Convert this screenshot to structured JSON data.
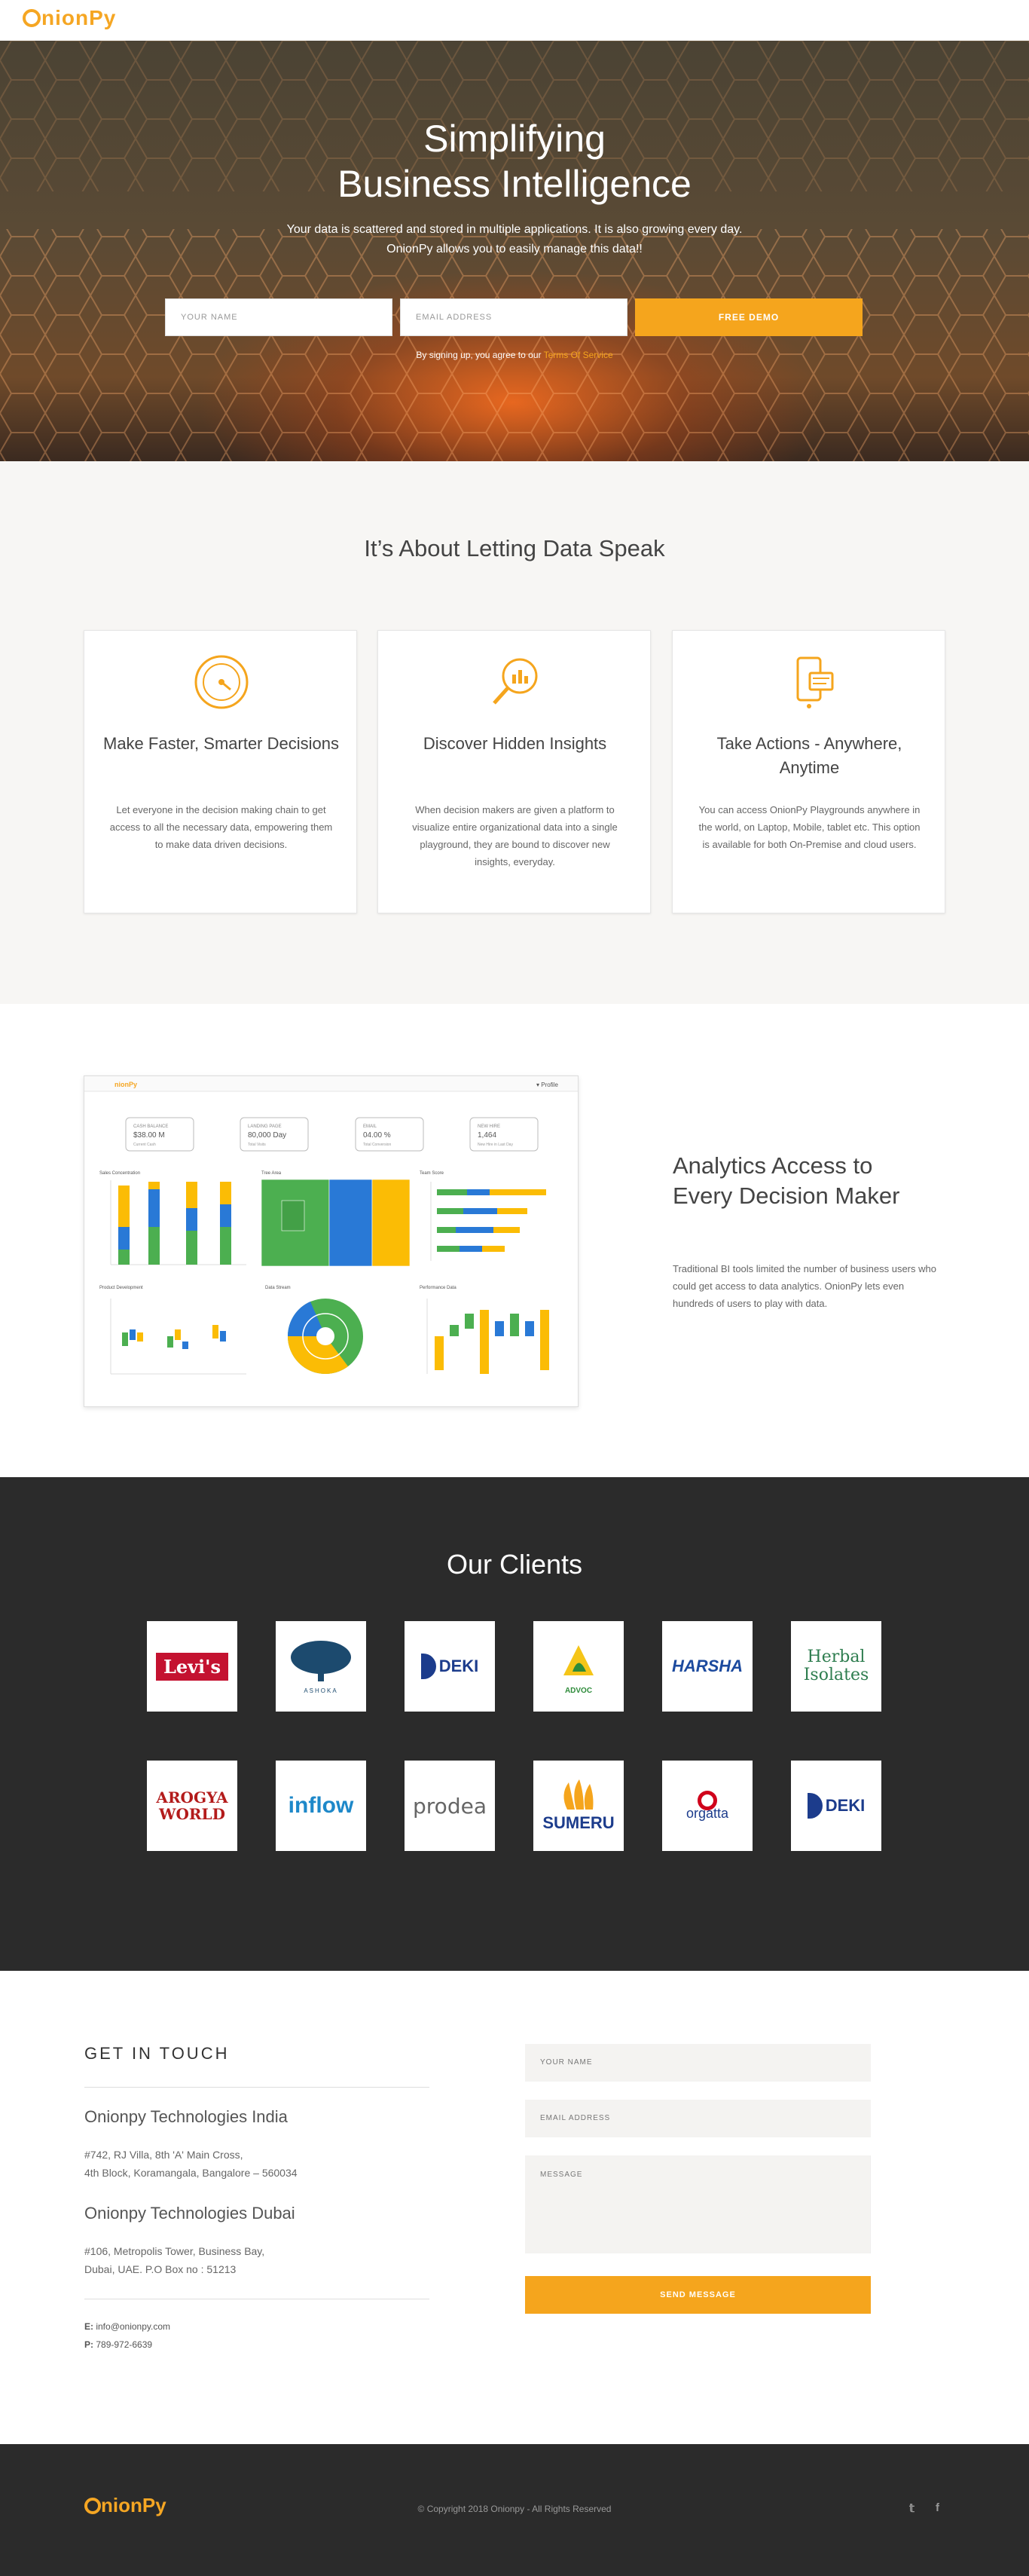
{
  "nav": {
    "logo_text": "nionPy"
  },
  "hero": {
    "title_line1": "Simplifying",
    "title_line2": "Business Intelligence",
    "subtitle_line1": "Your data is scattered and stored in multiple applications. It is also growing every day.",
    "subtitle_line2": "OnionPy allows you to easily manage this data!!",
    "name_placeholder": "YOUR NAME",
    "email_placeholder": "EMAIL ADDRESS",
    "demo_button": "FREE DEMO",
    "terms_prefix": "By signing up, you agree to our ",
    "terms_link": "Terms Of Service"
  },
  "features": {
    "heading": "It’s About Letting Data Speak",
    "cards": [
      {
        "title": "Make Faster, Smarter Decisions",
        "icon": "speedometer-icon",
        "text": "Let everyone in the decision making chain to get access to all the necessary data, empowering them to make data driven decisions."
      },
      {
        "title": "Discover Hidden Insights",
        "icon": "magnifier-chart-icon",
        "text": "When decision makers are given a platform to visualize entire organizational data into a single playground, they are bound to discover new insights, everyday."
      },
      {
        "title": "Take Actions - Anywhere, Anytime",
        "icon": "mobile-devices-icon",
        "text": "You can access OnionPy Playgrounds anywhere in the world, on Laptop, Mobile, tablet etc. This option is available for both On-Premise and cloud users."
      }
    ]
  },
  "analytics": {
    "heading": "Analytics Access to Every Decision Maker",
    "text": "Traditional BI tools limited the number of business users who could get access to data analytics. OnionPy lets even hundreds of users to play with data.",
    "dashboard": {
      "logo": "nionPy",
      "profile": "▾ Profile",
      "kpis": [
        {
          "label": "CASH BALANCE",
          "value": "$38.00 M",
          "sub": "Current Cash"
        },
        {
          "label": "LANDING PAGE",
          "value": "80,000 Day",
          "sub": "Total Visits"
        },
        {
          "label": "EMAIL",
          "value": "04.00 %",
          "sub": "Total Conversion"
        },
        {
          "label": "NEW HIRE",
          "value": "1,464",
          "sub": "New Hire in Last Day"
        }
      ],
      "chart_titles": [
        "Sales Concentration",
        "Tree Area",
        "Team Score",
        "Product Development",
        "Data Stream",
        "Performance Data"
      ],
      "colors": {
        "green": "#4caf50",
        "blue": "#2979d6",
        "yellow": "#fbbc05"
      }
    }
  },
  "clients": {
    "heading": "Our Clients",
    "logos": [
      {
        "name": "levis",
        "text": "Levi's",
        "color": "#c41230"
      },
      {
        "name": "ashoka",
        "text": "ASHOKA",
        "color": "#1c4a6e"
      },
      {
        "name": "deki",
        "text": "DEKI",
        "color": "#1c3c8c"
      },
      {
        "name": "advoc",
        "text": "ADVOC",
        "color": "#2e8b3a"
      },
      {
        "name": "harsha",
        "text": "HARSHA",
        "color": "#1c4a9e"
      },
      {
        "name": "herbal-isolates",
        "text": "Herbal Isolates",
        "color": "#2e7d4f"
      },
      {
        "name": "arogya-world",
        "text": "AROGYA WORLD",
        "color": "#b31b1b"
      },
      {
        "name": "inflow",
        "text": "inflow",
        "color": "#1e88c9"
      },
      {
        "name": "prodea",
        "text": "prodea",
        "color": "#666"
      },
      {
        "name": "sumeru",
        "text": "SUMERU",
        "color": "#1c3c8c"
      },
      {
        "name": "orgatta",
        "text": "orgatta",
        "color": "#1c3c8c"
      },
      {
        "name": "deki-2",
        "text": "DEKI",
        "color": "#1c3c8c"
      }
    ]
  },
  "contact": {
    "heading": "GET IN TOUCH",
    "office1_name": "Onionpy Technologies India",
    "office1_line1": "#742, RJ Villa, 8th 'A' Main Cross,",
    "office1_line2": "4th Block, Koramangala, Bangalore – 560034",
    "office2_name": "Onionpy Technologies Dubai",
    "office2_line1": "#106, Metropolis Tower, Business Bay,",
    "office2_line2": "Dubai, UAE. P.O Box no : 51213",
    "email_label": "E:",
    "email": "info@onionpy.com",
    "phone_label": "P:",
    "phone": "789-972-6639",
    "form": {
      "name_placeholder": "YOUR NAME",
      "email_placeholder": "EMAIL ADDRESS",
      "message_placeholder": "MESSAGE",
      "send_button": "SEND MESSAGE"
    }
  },
  "footer": {
    "logo_text": "nionPy",
    "copyright": "© Copyright 2018 Onionpy - All Rights Reserved",
    "social": [
      {
        "name": "twitter-icon",
        "glyph": "𝕥"
      },
      {
        "name": "facebook-icon",
        "glyph": "f"
      }
    ]
  }
}
